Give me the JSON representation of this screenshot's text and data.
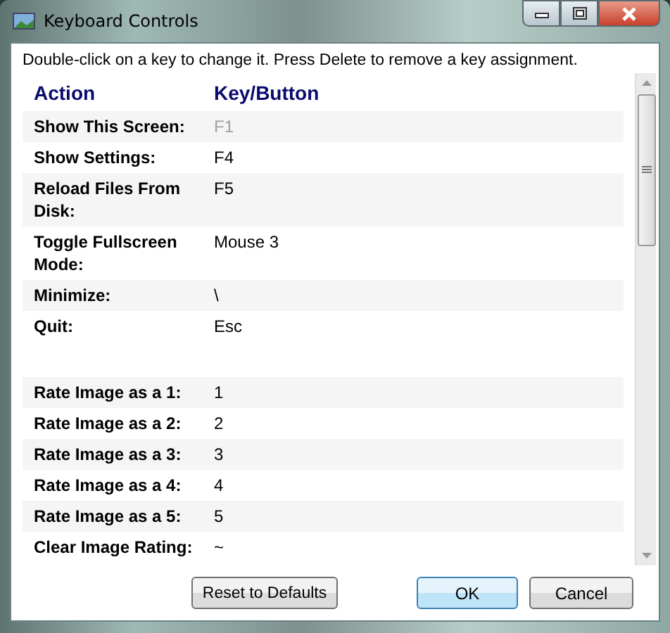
{
  "window": {
    "title": "Keyboard Controls"
  },
  "instructions": "Double-click on a key to change it. Press Delete to remove a key assignment.",
  "table": {
    "columns": [
      "Action",
      "Key/Button"
    ],
    "groups": [
      [
        {
          "action": "Show This Screen:",
          "key": "F1",
          "disabled": true
        },
        {
          "action": "Show Settings:",
          "key": "F4",
          "disabled": false
        },
        {
          "action": "Reload Files From Disk:",
          "key": "F5",
          "disabled": false
        },
        {
          "action": "Toggle Fullscreen Mode:",
          "key": "Mouse 3",
          "disabled": false
        },
        {
          "action": "Minimize:",
          "key": "\\",
          "disabled": false
        },
        {
          "action": "Quit:",
          "key": "Esc",
          "disabled": false
        }
      ],
      [
        {
          "action": "Rate Image as a 1:",
          "key": "1",
          "disabled": false
        },
        {
          "action": "Rate Image as a 2:",
          "key": "2",
          "disabled": false
        },
        {
          "action": "Rate Image as a 3:",
          "key": "3",
          "disabled": false
        },
        {
          "action": "Rate Image as a 4:",
          "key": "4",
          "disabled": false
        },
        {
          "action": "Rate Image as a 5:",
          "key": "5",
          "disabled": false
        },
        {
          "action": "Clear Image Rating:",
          "key": "~",
          "disabled": false
        }
      ]
    ]
  },
  "buttons": [
    {
      "label": "Reset to Defaults",
      "kind": "secondary"
    },
    {
      "label": "OK",
      "kind": "default"
    },
    {
      "label": "Cancel",
      "kind": "normal"
    }
  ]
}
